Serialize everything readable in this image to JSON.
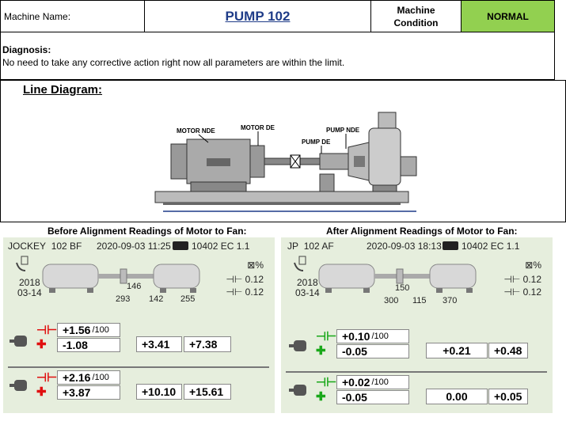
{
  "header": {
    "machine_name_label": "Machine Name:",
    "machine_name": "PUMP 102",
    "condition_label_1": "Machine",
    "condition_label_2": "Condition",
    "condition_value": "NORMAL",
    "condition_color": "#92d050"
  },
  "diagnosis": {
    "title": "Diagnosis:",
    "text": "No need to take any corrective action right now all parameters are within the limit."
  },
  "line_diagram": {
    "title": "Line Diagram:",
    "labels": {
      "motor_nde": "MOTOR NDE",
      "motor_de": "MOTOR DE",
      "pump_de": "PUMP DE",
      "pump_nde": "PUMP NDE"
    }
  },
  "before": {
    "title": "Before Alignment Readings of Motor to Fan:",
    "machine": "JOCKEY",
    "tag": "102 BF",
    "datetime": "2020-09-03 11:25",
    "serial": "10402 EC 1.1",
    "year": "2018",
    "monthday": "03-14",
    "tol_1": "0.12",
    "tol_2": "0.12",
    "dims": {
      "d1": "146",
      "d2": "293",
      "d3": "142",
      "d4": "255"
    },
    "row1": {
      "v1": "+1.56",
      "res": "/100",
      "v2": "-1.08",
      "f1": "+3.41",
      "f2": "+7.38"
    },
    "row2": {
      "v1": "+2.16",
      "res": "/100",
      "v2": "+3.87",
      "f1": "+10.10",
      "f2": "+15.61"
    }
  },
  "after": {
    "title": "After Alignment Readings of Motor to Fan:",
    "machine": "JP",
    "tag": "102 AF",
    "datetime": "2020-09-03 18:13",
    "serial": "10402 EC 1.1",
    "year": "2018",
    "monthday": "03-14",
    "tol_1": "0.12",
    "tol_2": "0.12",
    "dims": {
      "d1": "150",
      "d2": "300",
      "d3": "115",
      "d4": "370"
    },
    "row1": {
      "v1": "+0.10",
      "res": "/100",
      "v2": "-0.05",
      "f1": "+0.21",
      "f2": "+0.48"
    },
    "row2": {
      "v1": "+0.02",
      "res": "/100",
      "v2": "-0.05",
      "f1": "0.00",
      "f2": "+0.05"
    }
  }
}
